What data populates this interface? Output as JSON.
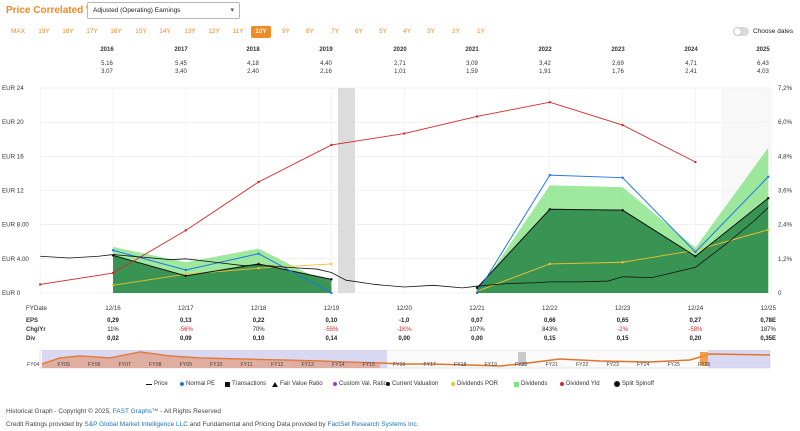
{
  "header": {
    "title": "Price Correlated With",
    "selected_metric": "Adjusted (Operating) Earnings"
  },
  "ranges": [
    "MAX",
    "19Y",
    "18Y",
    "17Y",
    "16Y",
    "15Y",
    "14Y",
    "13Y",
    "12Y",
    "11Y",
    "10Y",
    "9Y",
    "8Y",
    "7Y",
    "6Y",
    "5Y",
    "4Y",
    "3Y",
    "2Y",
    "1Y"
  ],
  "active_range": "10Y",
  "choose_dates_label": "Choose dates",
  "year_header": {
    "years": [
      "2016",
      "2017",
      "2018",
      "2019",
      "2020",
      "2021",
      "2022",
      "2023",
      "2024",
      "2025"
    ],
    "row1": [
      "5,16",
      "5,45",
      "4,18",
      "4,40",
      "2,71",
      "3,09",
      "3,42",
      "2,69",
      "4,71",
      "6,43"
    ],
    "row2": [
      "3,07",
      "3,40",
      "2,40",
      "2,16",
      "1,01",
      "1,59",
      "1,91",
      "1,76",
      "2,41",
      "4,03"
    ]
  },
  "colors": {
    "accent": "#f08a24",
    "price": "#111111",
    "normal_pe": "#1f77e6",
    "eps_fill": "#2e8b4a",
    "dividends": "#7ee27e",
    "dividend_yield": "#d62728",
    "dividends_por": "#f2c12e"
  },
  "chart_data": {
    "type": "area",
    "title": "",
    "left_axis": {
      "ticks": [
        "EUR 0",
        "EUR 4,00",
        "EUR 8,00",
        "EUR 12",
        "EUR 16",
        "EUR 20",
        "EUR 24"
      ],
      "ylim": [
        0,
        24
      ]
    },
    "right_axis": {
      "ticks": [
        "0",
        "1,2%",
        "2,4%",
        "3,6%",
        "4,8%",
        "6,0%",
        "7,2%"
      ],
      "ylim": [
        0,
        7.2
      ]
    },
    "fy_date_label": "FYDate",
    "x_ticks": [
      "12/16",
      "12/17",
      "12/18",
      "12/19",
      "12/20",
      "12/21",
      "12/22",
      "12/23",
      "12/24",
      "12/25"
    ],
    "series": [
      {
        "name": "Normal PE",
        "type": "line",
        "x": [
          0,
          1,
          2,
          3,
          4,
          5,
          6,
          7,
          8,
          9
        ],
        "y": [
          5.0,
          2.7,
          4.6,
          0.0,
          null,
          0.0,
          13.8,
          13.5,
          4.8,
          13.6
        ]
      },
      {
        "name": "Fair Value Ratio",
        "type": "line",
        "x": [
          0,
          1,
          2,
          3,
          4,
          5,
          6,
          7,
          8,
          9
        ],
        "y": [
          4.4,
          2.0,
          3.4,
          1.6,
          null,
          0.6,
          9.8,
          9.7,
          4.3,
          11.1
        ]
      },
      {
        "name": "Dividends",
        "type": "area",
        "x": [
          0,
          1,
          2,
          3,
          4,
          5,
          6,
          7,
          8,
          9
        ],
        "y": [
          5.4,
          3.6,
          5.2,
          0.9,
          null,
          0.0,
          12.6,
          12.4,
          5.3,
          17.0
        ]
      },
      {
        "name": "Dividend Yld",
        "type": "line",
        "x": [
          -1,
          0,
          1,
          2,
          3,
          4,
          5,
          6,
          7,
          8
        ],
        "y": [
          0.3,
          0.7,
          2.2,
          3.9,
          5.2,
          5.6,
          6.2,
          6.7,
          5.9,
          4.6
        ]
      },
      {
        "name": "Dividends POR",
        "type": "line",
        "x": [
          0,
          1,
          2,
          3,
          4,
          5,
          6,
          7,
          8,
          9
        ],
        "y": [
          0.9,
          2.2,
          2.9,
          3.4,
          null,
          0.2,
          3.4,
          3.6,
          5.0,
          7.4
        ]
      },
      {
        "name": "Price",
        "type": "line",
        "x": [
          -1,
          -0.6,
          -0.2,
          0,
          0.4,
          0.8,
          1,
          1.4,
          1.8,
          2,
          2.4,
          2.8,
          3,
          3.2,
          3.6,
          4,
          4.4,
          4.8,
          5,
          5.4,
          5.8,
          6,
          6.4,
          6.8,
          7,
          7.4,
          7.8,
          8,
          8.4,
          8.8,
          9
        ],
        "y": [
          4.3,
          4.1,
          4.3,
          4.5,
          4.2,
          3.9,
          4.0,
          3.6,
          3.2,
          3.3,
          3.0,
          2.8,
          2.4,
          1.5,
          1.0,
          0.7,
          0.9,
          0.6,
          0.8,
          1.1,
          1.2,
          1.3,
          1.3,
          1.4,
          1.9,
          1.8,
          2.6,
          3.0,
          5.6,
          8.4,
          10.0
        ]
      }
    ]
  },
  "table": {
    "rows": [
      {
        "label": "EPS",
        "values": [
          "0,29",
          "0,13",
          "0,22",
          "0,10",
          "-1,0",
          "0,07",
          "0,66",
          "0,65",
          "0,27",
          "0,78E"
        ]
      },
      {
        "label": "Chg/Yr",
        "values": [
          "11%",
          "-56%",
          "70%",
          "-55%",
          "-1K%",
          "107%",
          "843%",
          "-2%",
          "-58%",
          "187%"
        ]
      },
      {
        "label": "Div",
        "values": [
          "0,02",
          "0,09",
          "0,10",
          "0,14",
          "0,00",
          "0,00",
          "0,15",
          "0,15",
          "0,20",
          "0,35E"
        ]
      }
    ]
  },
  "navigator": {
    "labels": [
      "FY04",
      "FY05",
      "FY06",
      "FY07",
      "FY08",
      "FY09",
      "FY10",
      "FY11",
      "FY12",
      "FY13",
      "FY14",
      "FY15",
      "FY16",
      "FY17",
      "FY18",
      "FY19",
      "FY20",
      "FY21",
      "FY22",
      "FY23",
      "FY24",
      "FY25",
      "FY26"
    ]
  },
  "legend": [
    {
      "label": "Price",
      "marker": "line-black"
    },
    {
      "label": "Normal PE",
      "marker": "dot-blue"
    },
    {
      "label": "Transactions",
      "marker": "square-black"
    },
    {
      "label": "Fair Value Ratio",
      "marker": "triangle-outline"
    },
    {
      "label": "Custom Val. Ratio",
      "marker": "dot-purple"
    },
    {
      "label": "Current Valuation",
      "marker": "dot-black"
    },
    {
      "label": "Dividends POR",
      "marker": "dot-yellow"
    },
    {
      "label": "Dividends",
      "marker": "square-green"
    },
    {
      "label": "Dividend Yld",
      "marker": "dot-red"
    },
    {
      "label": "Split Spinoff",
      "marker": "circle-black"
    }
  ],
  "footer": {
    "line1_prefix": "Historical Graph - Copyright © 2025, ",
    "line1_link": "FAST Graphs™",
    "line1_suffix": " - All Rights Reserved",
    "line2_prefix": "Credit Ratings provided by ",
    "line2_link1": "S&P Global Market Intelligence LLC",
    "line2_middle": " and Fundamental and Pricing Data provided by ",
    "line2_link2": "FactSet Research Systems Inc."
  }
}
